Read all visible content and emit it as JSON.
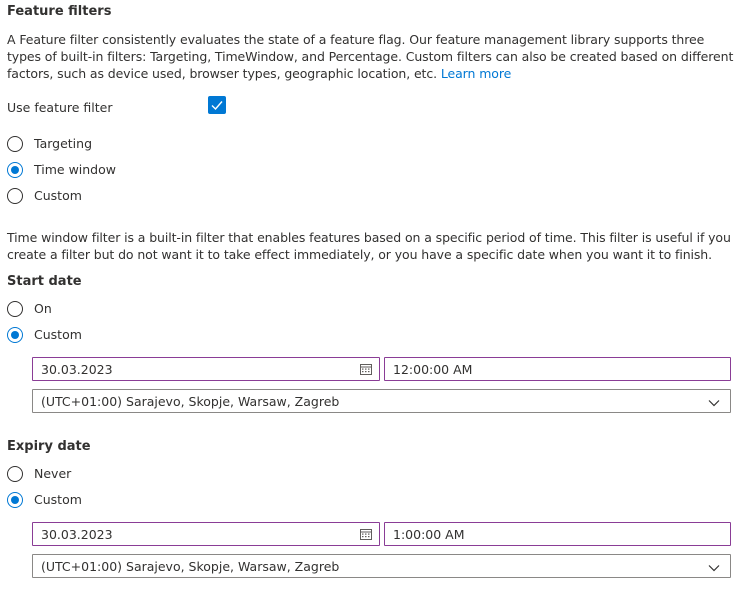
{
  "section": {
    "title": "Feature filters",
    "description": "A Feature filter consistently evaluates the state of a feature flag. Our feature management library supports three types of built-in filters: Targeting, TimeWindow, and Percentage. Custom filters can also be created based on different factors, such as device used, browser types, geographic location, etc.",
    "learn_more": "Learn more"
  },
  "use_filter": {
    "label": "Use feature filter",
    "checked": true
  },
  "filter_types": [
    {
      "label": "Targeting",
      "checked": false
    },
    {
      "label": "Time window",
      "checked": true
    },
    {
      "label": "Custom",
      "checked": false
    }
  ],
  "time_window_description": "Time window filter is a built-in filter that enables features based on a specific period of time. This filter is useful if you create a filter but do not want it to take effect immediately, or you have a specific date when you want it to finish.",
  "start": {
    "title": "Start date",
    "options": [
      {
        "label": "On",
        "checked": false
      },
      {
        "label": "Custom",
        "checked": true
      }
    ],
    "date": "30.03.2023",
    "time": "12:00:00 AM",
    "timezone": "(UTC+01:00) Sarajevo, Skopje, Warsaw, Zagreb"
  },
  "expiry": {
    "title": "Expiry date",
    "options": [
      {
        "label": "Never",
        "checked": false
      },
      {
        "label": "Custom",
        "checked": true
      }
    ],
    "date": "30.03.2023",
    "time": "1:00:00 AM",
    "timezone": "(UTC+01:00) Sarajevo, Skopje, Warsaw, Zagreb"
  },
  "colors": {
    "accent": "#0078d4",
    "focus_border": "#8a3d96",
    "text": "#323130"
  },
  "icons": {
    "checkbox": "checkmark-icon",
    "date_picker": "calendar-icon",
    "dropdown": "chevron-down-icon"
  }
}
